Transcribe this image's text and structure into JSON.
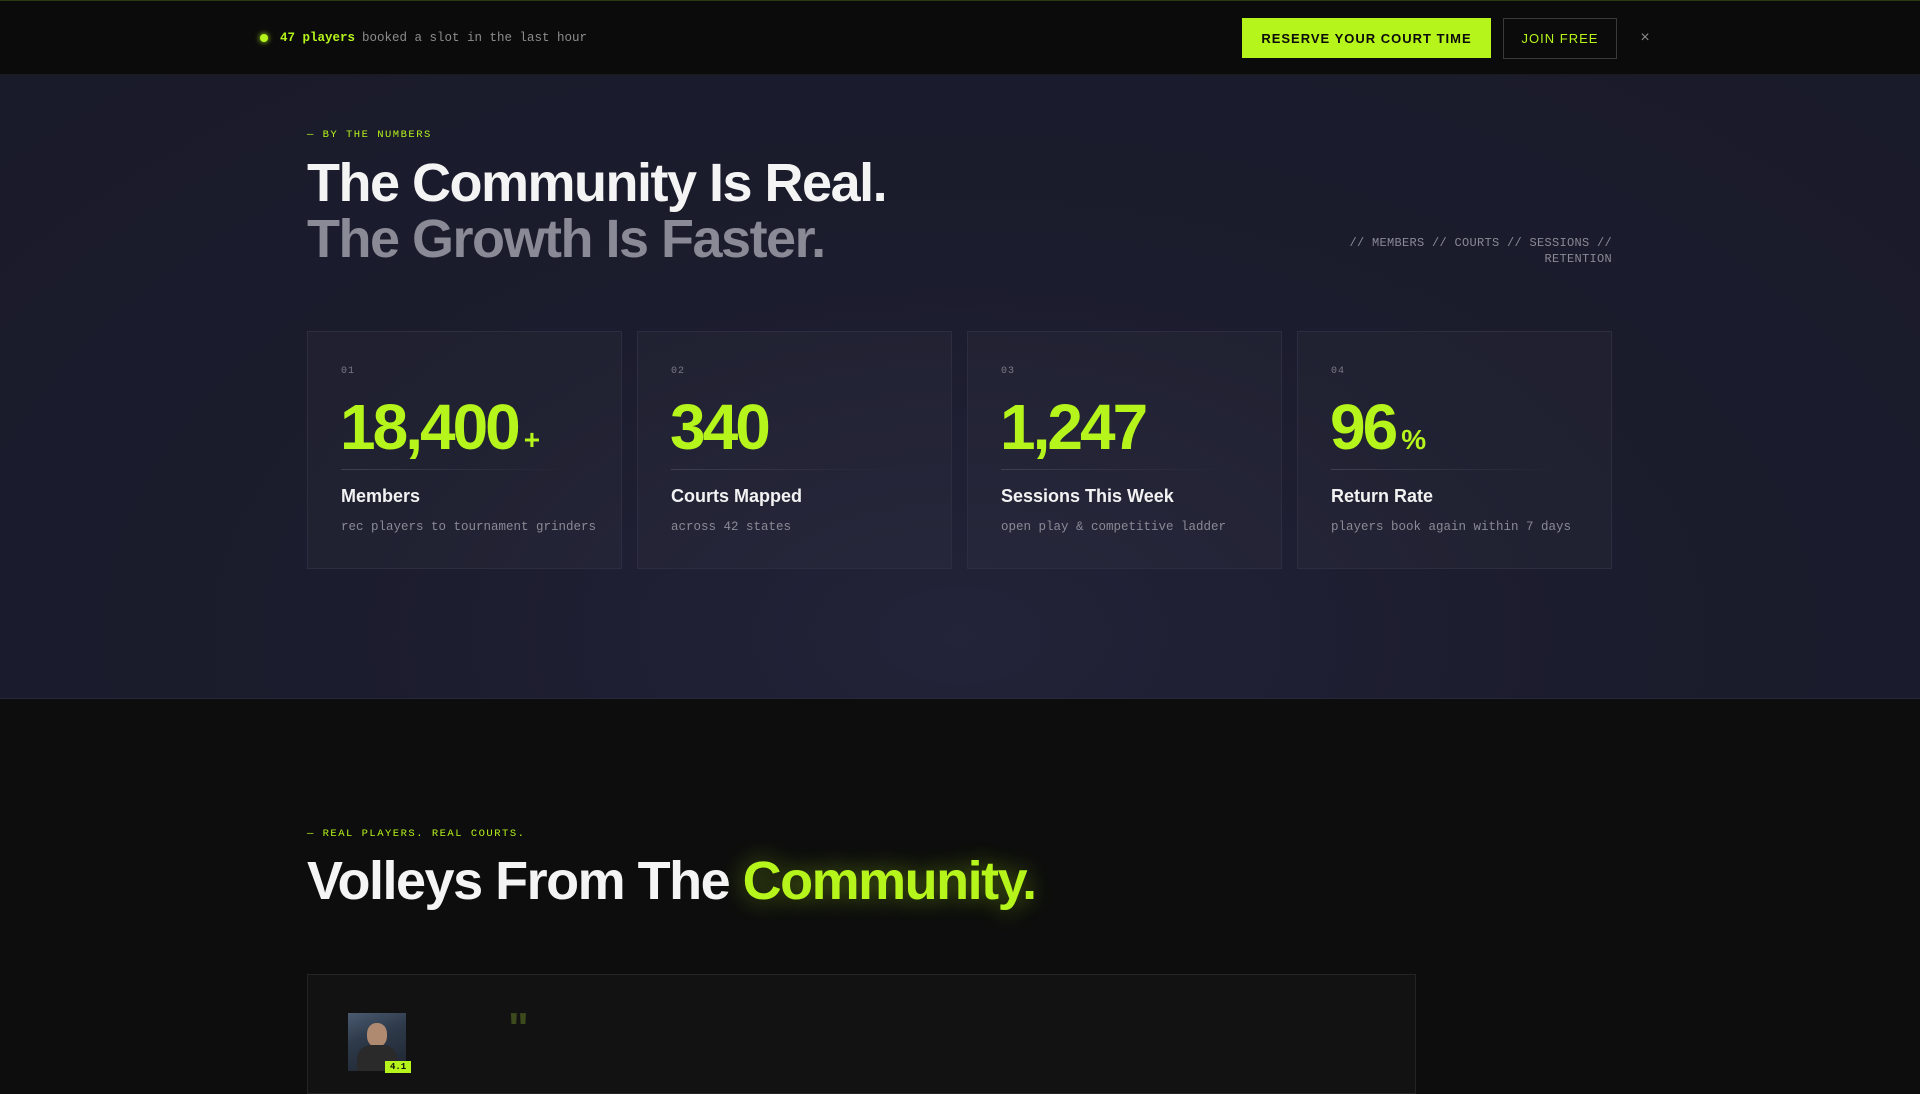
{
  "topbar": {
    "live_count": "47 players",
    "live_text": "booked a slot in the last hour",
    "reserve_label": "RESERVE YOUR COURT TIME",
    "join_label": "JOIN FREE",
    "close_label": "×"
  },
  "numbers": {
    "eyebrow": "— BY THE NUMBERS",
    "headline_line1": "The Community Is Real.",
    "headline_line2": "The Growth Is Faster.",
    "tagline": "// MEMBERS // COURTS // SESSIONS // RETENTION",
    "stats": [
      {
        "index": "01",
        "value": "18,400",
        "suffix": "+",
        "label": "Members",
        "desc": "rec players to tournament grinders"
      },
      {
        "index": "02",
        "value": "340",
        "suffix": "",
        "label": "Courts Mapped",
        "desc": "across 42 states"
      },
      {
        "index": "03",
        "value": "1,247",
        "suffix": "",
        "label": "Sessions This Week",
        "desc": "open play & competitive ladder"
      },
      {
        "index": "04",
        "value": "96",
        "suffix": "%",
        "label": "Return Rate",
        "desc": "players book again within 7 days"
      }
    ]
  },
  "community": {
    "eyebrow": "— REAL PLAYERS. REAL COURTS.",
    "headline_start": "Volleys From The ",
    "headline_highlight": "Community.",
    "testimonial": {
      "rating": "4.1",
      "quote_mark": "\""
    }
  },
  "colors": {
    "accent": "#b6f51b",
    "top_bg": "#0b0b0b",
    "section_bg": "#1b1c2d",
    "page_bg": "#0d0d0d"
  }
}
